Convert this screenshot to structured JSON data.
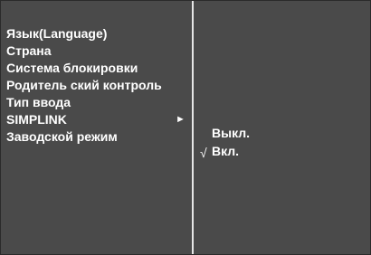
{
  "menu": {
    "items": [
      {
        "label": "Язык(Language)"
      },
      {
        "label": "Страна"
      },
      {
        "label": "Система блокировки"
      },
      {
        "label": "Родитель ский контроль"
      },
      {
        "label": "Тип ввода"
      },
      {
        "label": "SIMPLINK",
        "selected": true
      },
      {
        "label": "Заводской режим"
      }
    ],
    "selected_arrow": "►"
  },
  "submenu": {
    "options": [
      {
        "label": "Выкл.",
        "checked": false
      },
      {
        "label": "Вкл.",
        "checked": true
      }
    ],
    "check_mark": "√"
  },
  "icons": {
    "arrow": "right-triangle-icon",
    "check": "checkmark-icon"
  }
}
